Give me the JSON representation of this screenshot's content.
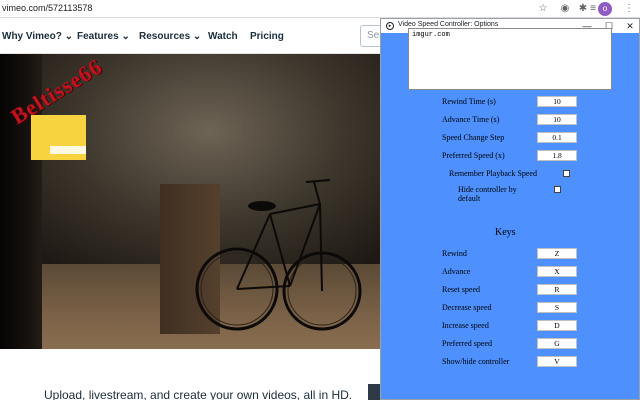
{
  "browser": {
    "url": "vimeo.com/572113578",
    "avatar_letter": "o"
  },
  "nav": {
    "items": [
      {
        "label": "Why Vimeo? ⌄"
      },
      {
        "label": "Features ⌄"
      },
      {
        "label": "Resources ⌄"
      },
      {
        "label": "Watch"
      },
      {
        "label": "Pricing"
      }
    ],
    "search_placeholder": "Sea"
  },
  "hero": {
    "watermark": "Beltisse66",
    "tagline": "Upload, livestream, and create your own videos, all in HD."
  },
  "popup": {
    "title": "Video Speed Controller: Options",
    "blacklist_text": "imgur.com",
    "settings": [
      {
        "label": "Rewind Time (s)",
        "value": "10"
      },
      {
        "label": "Advance Time (s)",
        "value": "10"
      },
      {
        "label": "Speed Change Step",
        "value": "0.1"
      },
      {
        "label": "Preferred Speed (x)",
        "value": "1.8"
      }
    ],
    "remember_label": "Remember Playback Speed",
    "hide_label_1": "Hide controller by",
    "hide_label_2": "default",
    "keys_title": "Keys",
    "keys": [
      {
        "label": "Rewind",
        "value": "Z"
      },
      {
        "label": "Advance",
        "value": "X"
      },
      {
        "label": "Reset speed",
        "value": "R"
      },
      {
        "label": "Decrease speed",
        "value": "S"
      },
      {
        "label": "Increase speed",
        "value": "D"
      },
      {
        "label": "Preferred speed",
        "value": "G"
      },
      {
        "label": "Show/hide controller",
        "value": "V"
      }
    ]
  },
  "colors": {
    "popup_background": "#4d90fe",
    "overlay_yellow": "#f6d33f",
    "watermark_red": "#c4121e"
  }
}
